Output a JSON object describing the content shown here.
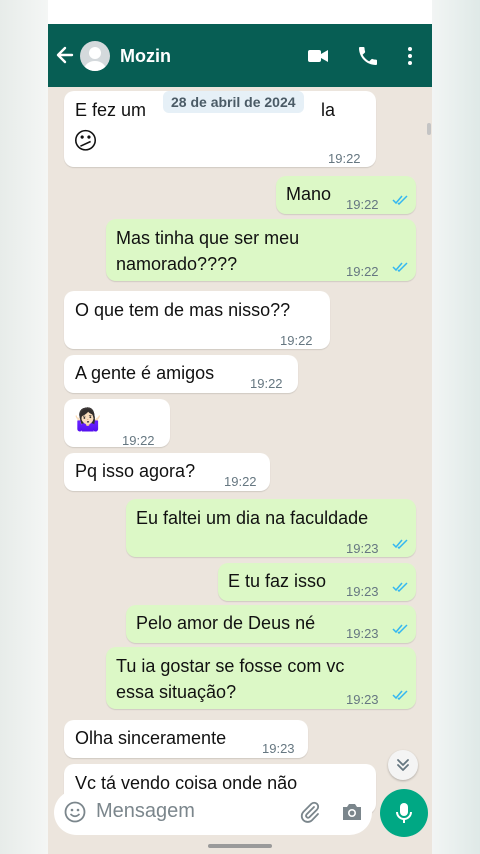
{
  "header": {
    "contact_name": "Mozin"
  },
  "date_chip": "28 de abril de 2024",
  "messages": [
    {
      "dir": "in",
      "line1": "E fez um",
      "line1_end": "la",
      "line2": "😕",
      "time": "19:22"
    },
    {
      "dir": "out",
      "text": "Mano",
      "time": "19:22"
    },
    {
      "dir": "out",
      "line1": "Mas tinha que ser meu",
      "line2": "namorado????",
      "time": "19:22"
    },
    {
      "dir": "in",
      "text": "O que tem de mas nisso??",
      "time": "19:22"
    },
    {
      "dir": "in",
      "text": "A gente é amigos",
      "time": "19:22"
    },
    {
      "dir": "in",
      "text": "🤷🏻‍♀️",
      "time": "19:22"
    },
    {
      "dir": "in",
      "text": "Pq isso agora?",
      "time": "19:22"
    },
    {
      "dir": "out",
      "text": "Eu faltei um dia na faculdade",
      "time": "19:23"
    },
    {
      "dir": "out",
      "text": "E tu faz isso",
      "time": "19:23"
    },
    {
      "dir": "out",
      "text": "Pelo amor de Deus né",
      "time": "19:23"
    },
    {
      "dir": "out",
      "line1": "Tu ia gostar se fosse com vc",
      "line2": "essa situação?",
      "time": "19:23"
    },
    {
      "dir": "in",
      "text": "Olha sinceramente",
      "time": "19:23"
    },
    {
      "dir": "in",
      "text": "Vc tá vendo coisa onde não",
      "time": ""
    }
  ],
  "input": {
    "placeholder": "Mensagem"
  },
  "colors": {
    "header": "#075e54",
    "outgoing": "#dcf8c6",
    "incoming": "#ffffff",
    "read_ticks": "#34b7f1",
    "mic": "#00a884"
  },
  "icons": [
    "back-arrow-icon",
    "avatar-icon",
    "video-call-icon",
    "phone-icon",
    "more-options-icon",
    "emoji-icon",
    "attach-icon",
    "camera-icon",
    "mic-icon",
    "double-chevron-down-icon",
    "read-ticks-icon"
  ]
}
